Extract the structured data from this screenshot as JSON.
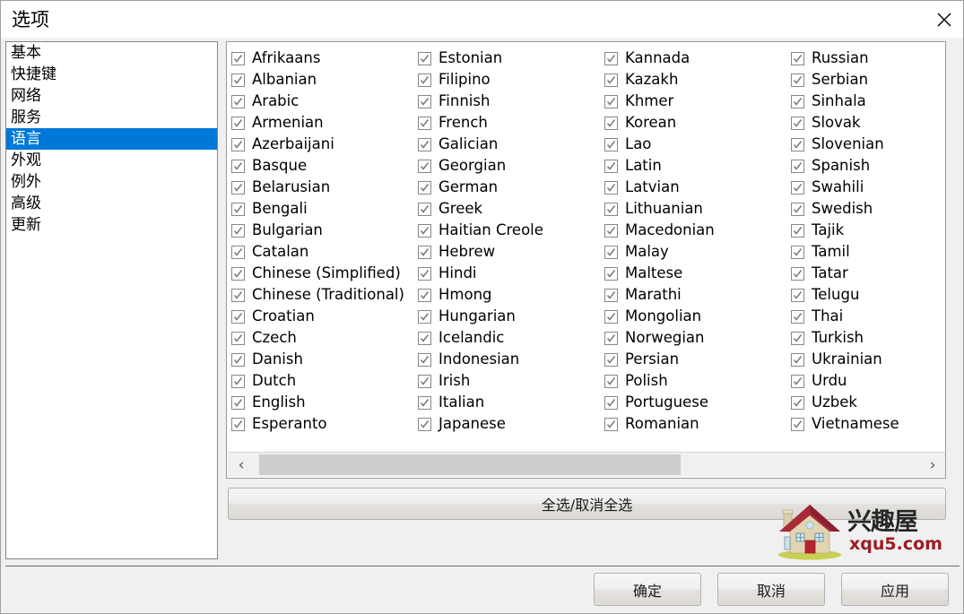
{
  "window": {
    "title": "选项",
    "close_icon": "close-icon"
  },
  "sidebar": {
    "selected_index": 4,
    "items": [
      {
        "label": "基本"
      },
      {
        "label": "快捷键"
      },
      {
        "label": "网络"
      },
      {
        "label": "服务"
      },
      {
        "label": "语言"
      },
      {
        "label": "外观"
      },
      {
        "label": "例外"
      },
      {
        "label": "高级"
      },
      {
        "label": "更新"
      }
    ]
  },
  "languages": {
    "all_checked": true,
    "columns": [
      [
        "Afrikaans",
        "Albanian",
        "Arabic",
        "Armenian",
        "Azerbaijani",
        "Basque",
        "Belarusian",
        "Bengali",
        "Bulgarian",
        "Catalan",
        "Chinese (Simplified)",
        "Chinese (Traditional)",
        "Croatian",
        "Czech",
        "Danish",
        "Dutch",
        "English",
        "Esperanto"
      ],
      [
        "Estonian",
        "Filipino",
        "Finnish",
        "French",
        "Galician",
        "Georgian",
        "German",
        "Greek",
        "Haitian Creole",
        "Hebrew",
        "Hindi",
        "Hmong",
        "Hungarian",
        "Icelandic",
        "Indonesian",
        "Irish",
        "Italian",
        "Japanese"
      ],
      [
        "Kannada",
        "Kazakh",
        "Khmer",
        "Korean",
        "Lao",
        "Latin",
        "Latvian",
        "Lithuanian",
        "Macedonian",
        "Malay",
        "Maltese",
        "Marathi",
        "Mongolian",
        "Norwegian",
        "Persian",
        "Polish",
        "Portuguese",
        "Romanian"
      ],
      [
        "Russian",
        "Serbian",
        "Sinhala",
        "Slovak",
        "Slovenian",
        "Spanish",
        "Swahili",
        "Swedish",
        "Tajik",
        "Tamil",
        "Tatar",
        "Telugu",
        "Thai",
        "Turkish",
        "Ukrainian",
        "Urdu",
        "Uzbek",
        "Vietnamese"
      ]
    ]
  },
  "scrollbar": {
    "left_arrow": "‹",
    "right_arrow": "›"
  },
  "select_all": {
    "label": "全选/取消全选"
  },
  "watermark": {
    "brand": "兴趣屋",
    "url": "xqu5.com"
  },
  "footer": {
    "ok_label": "确定",
    "cancel_label": "取消",
    "apply_label": "应用"
  },
  "colors": {
    "accent": "#0078d7",
    "panel_bg": "#f0f0f0",
    "list_bg": "#ffffff",
    "scroll_thumb": "#cdcdcd",
    "watermark_red": "#9d1c22",
    "roof_red": "#a82b3a",
    "wall_beige": "#e0d5b0"
  }
}
